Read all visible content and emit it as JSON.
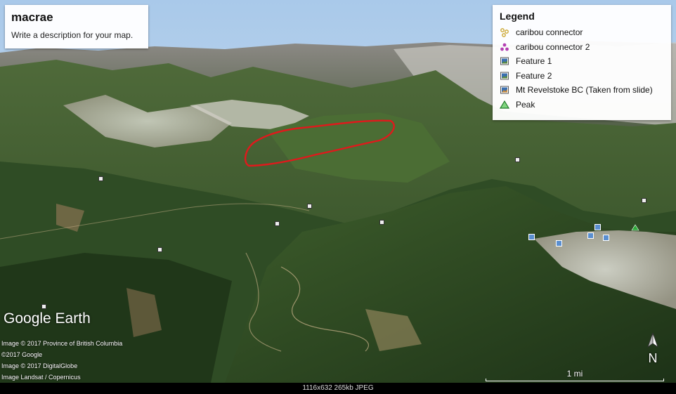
{
  "map": {
    "title": "macrae",
    "description": "Write a description for your map."
  },
  "legend": {
    "heading": "Legend",
    "items": [
      {
        "label": "caribou connector",
        "icon": "caribou-connector-path-icon",
        "color": "#c9a227"
      },
      {
        "label": "caribou connector 2",
        "icon": "caribou-connector-2-path-icon",
        "color": "#b33fb3"
      },
      {
        "label": "Feature 1",
        "icon": "photo-overlay-icon",
        "color": "#3a6fb0"
      },
      {
        "label": "Feature 2",
        "icon": "photo-overlay-icon",
        "color": "#3a6fb0"
      },
      {
        "label": "Mt Revelstoke BC (Taken from slide)",
        "icon": "photo-overlay-icon",
        "color": "#3a6fb0"
      },
      {
        "label": "Peak",
        "icon": "peak-triangle-icon",
        "color": "#2eaa3a"
      }
    ]
  },
  "branding": "Google Earth",
  "credits": [
    "Image © 2017 Province of British Columbia",
    "©2017 Google",
    "Image © 2017 DigitalGlobe",
    "Image Landsat / Copernicus"
  ],
  "scale_label": "1 mi",
  "compass_label": "N",
  "footer": "1116x632 265kb JPEG",
  "colors": {
    "route": "#e0191c",
    "sky": "#bcd7ee",
    "forest": "#2e4a22",
    "snow": "#dcdcd2"
  }
}
